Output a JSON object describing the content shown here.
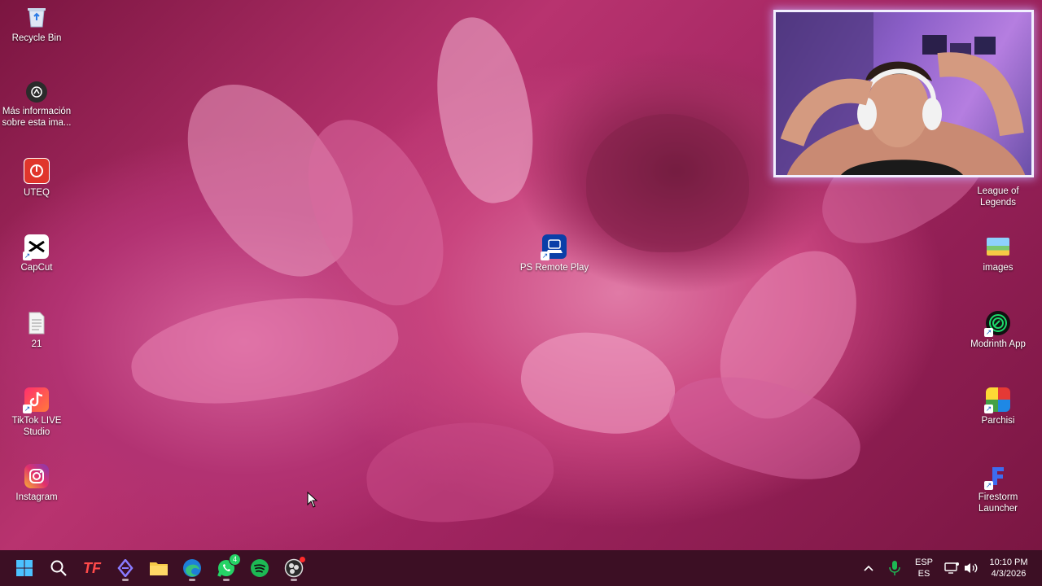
{
  "desktop": {
    "left_icons": [
      {
        "label": "Recycle Bin",
        "icon": "recycle-bin-icon"
      },
      {
        "label": "Más información sobre esta ima...",
        "icon": "info-camera-icon"
      },
      {
        "label": "UTEQ",
        "icon": "uteq-icon"
      },
      {
        "label": "CapCut",
        "icon": "capcut-icon"
      },
      {
        "label": "21",
        "icon": "text-file-icon"
      },
      {
        "label": "TikTok LIVE Studio",
        "icon": "tiktok-live-icon"
      },
      {
        "label": "Instagram",
        "icon": "instagram-icon"
      }
    ],
    "center_icons": [
      {
        "label": "PS Remote Play",
        "icon": "ps-remote-play-icon"
      }
    ],
    "right_icons": [
      {
        "label": "League of Legends",
        "icon": "league-of-legends-icon"
      },
      {
        "label": "images",
        "icon": "images-icon"
      },
      {
        "label": "Modrinth App",
        "icon": "modrinth-icon"
      },
      {
        "label": "Parchisi",
        "icon": "parchisi-icon"
      },
      {
        "label": "Firestorm Launcher",
        "icon": "firestorm-icon"
      }
    ]
  },
  "taskbar": {
    "apps": [
      {
        "name": "start",
        "icon": "windows-start-icon"
      },
      {
        "name": "search",
        "icon": "search-icon"
      },
      {
        "name": "tf",
        "icon": "tf-icon",
        "text": "TF"
      },
      {
        "name": "hub",
        "icon": "diamond-hub-icon"
      },
      {
        "name": "file-explorer",
        "icon": "folder-icon"
      },
      {
        "name": "edge",
        "icon": "edge-icon"
      },
      {
        "name": "whatsapp",
        "icon": "whatsapp-icon",
        "badge": "4"
      },
      {
        "name": "spotify",
        "icon": "spotify-icon"
      },
      {
        "name": "obs",
        "icon": "obs-icon"
      }
    ],
    "tray": {
      "language_top": "ESP",
      "language_bottom": "ES",
      "time": "10:10 PM",
      "date": "4/3/2026"
    }
  },
  "colors": {
    "taskbar_bg": "#3c0f24",
    "webcam_border": "#f2f0ff",
    "whatsapp_green": "#25d366",
    "spotify_green": "#1db954"
  }
}
